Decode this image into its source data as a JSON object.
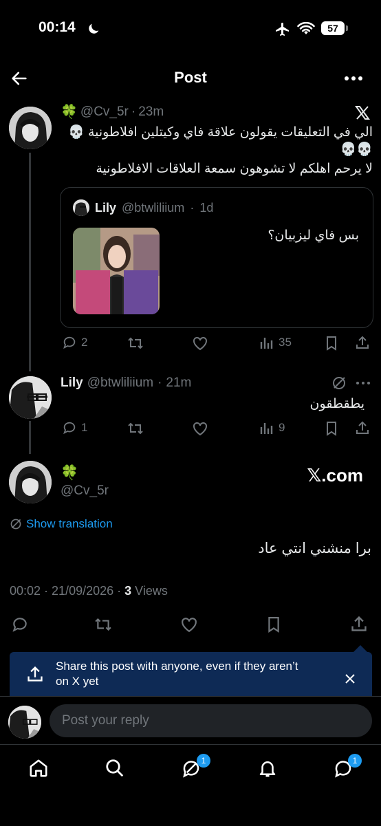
{
  "status_bar": {
    "time": "00:14",
    "battery": "57"
  },
  "header": {
    "title": "Post"
  },
  "thread": [
    {
      "emoji": "🍀",
      "handle": "@Cv_5r",
      "time": "23m",
      "text_line1": "الي في التعليقات يقولون علاقة فاي وكيتلين افلاطونية 💀",
      "text_line2": "💀💀",
      "text_line3": "لا يرحم اهلكم لا تشوهون سمعة العلاقات الافلاطونية",
      "quote": {
        "name": "Lily",
        "handle": "@btwliliium",
        "time": "1d",
        "text": "بس فاي ليزبيان؟"
      },
      "actions": {
        "replies": "2",
        "views": "35"
      }
    },
    {
      "name": "Lily",
      "handle": "@btwliliium",
      "time": "21m",
      "text": "يطقطقون",
      "actions": {
        "replies": "1",
        "views": "9"
      }
    }
  ],
  "main_post": {
    "emoji": "🍀",
    "handle": "@Cv_5r",
    "xcom_label": "𝕏.com",
    "translation_link": "Show translation",
    "text": "برا منشني انتي عاد",
    "timestamp": "00:02 · 21/09/2026 · ",
    "views_count": "3",
    "views_label": "Views"
  },
  "share_banner": {
    "text": "Share this post with anyone, even if they aren’t on X yet"
  },
  "reply": {
    "placeholder": "Post your reply"
  },
  "tabbar": {
    "grok_badge": "1",
    "messages_badge": "1"
  }
}
